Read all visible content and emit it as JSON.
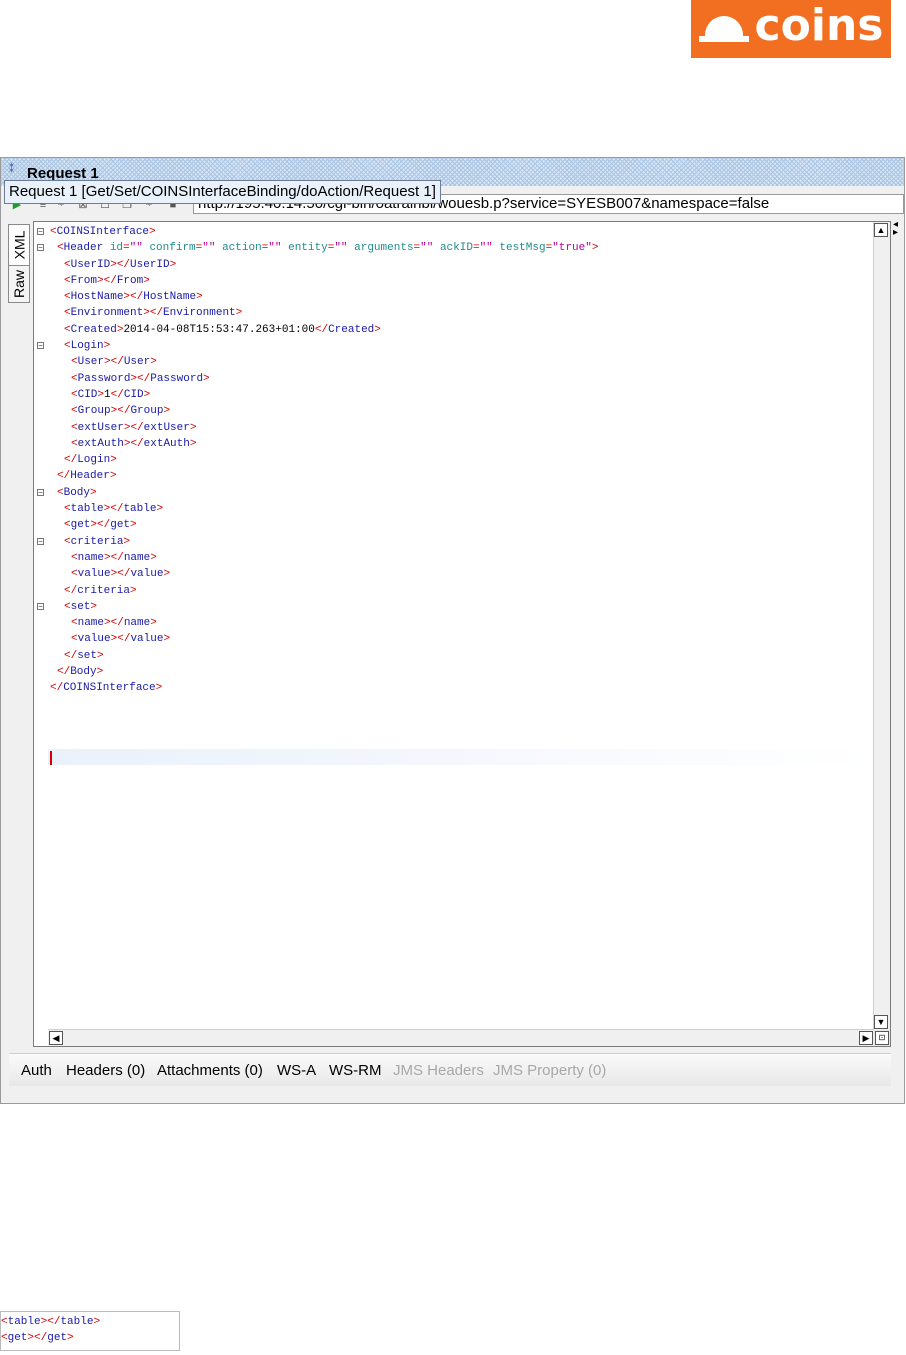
{
  "logo": {
    "text": "coins",
    "icon": "hard-hat-icon",
    "color": "#f26f21"
  },
  "window": {
    "title": "Request 1",
    "tooltip": "Request 1 [Get/Set/COINSInterfaceBinding/doAction/Request 1]",
    "url": "http://195.40.14.50/cgi-bin/oatrainbl/wouesb.p?service=SYESB007&namespace=false"
  },
  "side_tabs": [
    "XML",
    "Raw"
  ],
  "code": {
    "lines": [
      {
        "o": "<",
        "n": "COINSInterface",
        "c": ">"
      },
      {
        "o": "<",
        "n": "Header",
        "a": [
          [
            "id",
            "\"\""
          ],
          [
            "confirm",
            "\"\""
          ],
          [
            "action",
            "\"\""
          ],
          [
            "entity",
            "\"\""
          ],
          [
            "arguments",
            "\"\""
          ],
          [
            "ackID",
            "\"\""
          ],
          [
            "testMsg",
            "\"true\""
          ]
        ],
        "c": ">"
      },
      {
        "o": "<",
        "n": "UserID",
        "m": "",
        "e": "UserID"
      },
      {
        "o": "<",
        "n": "From",
        "m": "",
        "e": "From"
      },
      {
        "o": "<",
        "n": "HostName",
        "m": "",
        "e": "HostName"
      },
      {
        "o": "<",
        "n": "Environment",
        "m": "",
        "e": "Environment"
      },
      {
        "o": "<",
        "n": "Created",
        "m": "2014-04-08T15:53:47.263+01:00",
        "e": "Created"
      },
      {
        "o": "<",
        "n": "Login",
        "c": ">"
      },
      {
        "o": "<",
        "n": "User",
        "m": "",
        "e": "User"
      },
      {
        "o": "<",
        "n": "Password",
        "m": "",
        "e": "Password"
      },
      {
        "o": "<",
        "n": "CID",
        "m": "1",
        "e": "CID"
      },
      {
        "o": "<",
        "n": "Group",
        "m": "",
        "e": "Group"
      },
      {
        "o": "<",
        "n": "extUser",
        "m": "",
        "e": "extUser"
      },
      {
        "o": "<",
        "n": "extAuth",
        "m": "",
        "e": "extAuth"
      },
      {
        "o": "</",
        "n": "Login",
        "c": ">"
      },
      {
        "o": "</",
        "n": "Header",
        "c": ">"
      },
      {
        "o": "<",
        "n": "Body",
        "c": ">"
      },
      {
        "o": "<",
        "n": "table",
        "m": "",
        "e": "table"
      },
      {
        "o": "<",
        "n": "get",
        "m": "",
        "e": "get"
      },
      {
        "o": "<",
        "n": "criteria",
        "c": ">"
      },
      {
        "o": "<",
        "n": "name",
        "m": "",
        "e": "name"
      },
      {
        "o": "<",
        "n": "value",
        "m": "",
        "e": "value"
      },
      {
        "o": "</",
        "n": "criteria",
        "c": ">"
      },
      {
        "o": "<",
        "n": "set",
        "c": ">"
      },
      {
        "o": "<",
        "n": "name",
        "m": "",
        "e": "name"
      },
      {
        "o": "<",
        "n": "value",
        "m": "",
        "e": "value"
      },
      {
        "o": "</",
        "n": "set",
        "c": ">"
      },
      {
        "o": "</",
        "n": "Body",
        "c": ">"
      },
      {
        "o": "</",
        "n": "COINSInterface",
        "c": ">"
      }
    ]
  },
  "bottom_tabs": [
    {
      "label": "Auth",
      "enabled": true
    },
    {
      "label": "Headers (0)",
      "enabled": true
    },
    {
      "label": "Attachments (0)",
      "enabled": true
    },
    {
      "label": "WS-A",
      "enabled": true
    },
    {
      "label": "WS-RM",
      "enabled": true
    },
    {
      "label": "JMS Headers",
      "enabled": false
    },
    {
      "label": "JMS Property (0)",
      "enabled": false
    }
  ],
  "snippet": {
    "lines": [
      {
        "o": "<",
        "n": "table",
        "m": "",
        "e": "table"
      },
      {
        "o": "<",
        "n": "get",
        "m": "",
        "e": "get"
      }
    ]
  },
  "colors": {
    "tag": "#d40000",
    "name": "#1a1aa6",
    "attr": "#228b8b",
    "string": "#b4009e"
  }
}
